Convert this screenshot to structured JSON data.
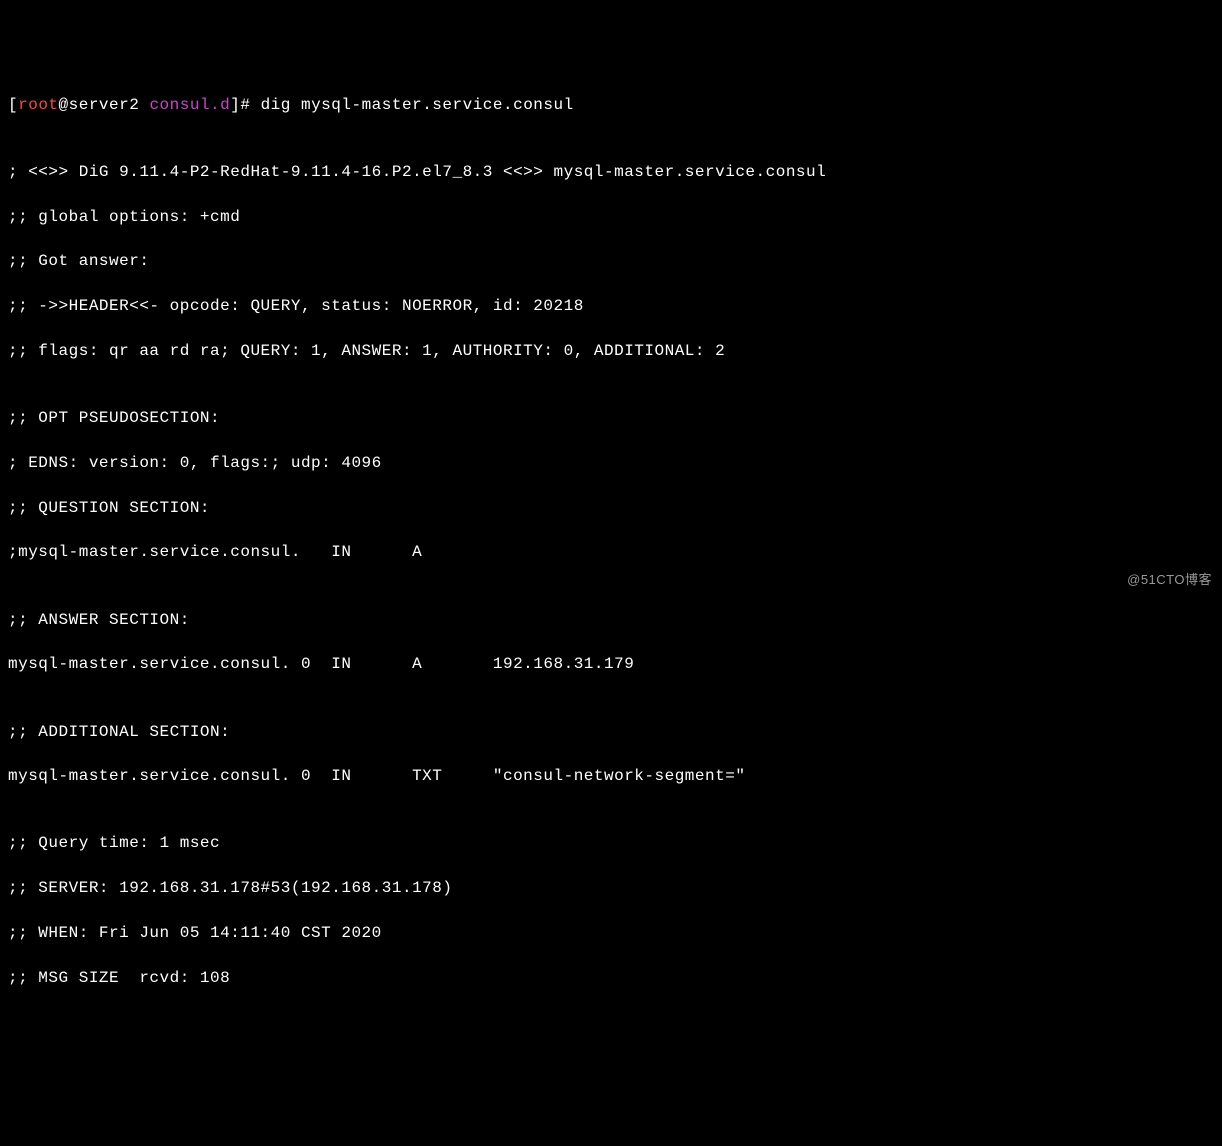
{
  "prompt": {
    "open_bracket": "[",
    "user": "root",
    "at": "@server2 ",
    "dir": "consul.d",
    "close_bracket": "]# ",
    "command": "dig mysql-master.service.consul"
  },
  "output": {
    "blank1": "",
    "banner": "; <<>> DiG 9.11.4-P2-RedHat-9.11.4-16.P2.el7_8.3 <<>> mysql-master.service.consul",
    "global_options": ";; global options: +cmd",
    "got_answer": ";; Got answer:",
    "header": ";; ->>HEADER<<- opcode: QUERY, status: NOERROR, id: 20218",
    "flags": ";; flags: qr aa rd ra; QUERY: 1, ANSWER: 1, AUTHORITY: 0, ADDITIONAL: 2",
    "blank2": "",
    "opt_header": ";; OPT PSEUDOSECTION:",
    "edns": "; EDNS: version: 0, flags:; udp: 4096",
    "question_header": ";; QUESTION SECTION:",
    "question_record": ";mysql-master.service.consul.   IN      A",
    "blank3": "",
    "answer_header": ";; ANSWER SECTION:",
    "answer_record": "mysql-master.service.consul. 0  IN      A       192.168.31.179",
    "blank4": "",
    "additional_header": ";; ADDITIONAL SECTION:",
    "additional_record": "mysql-master.service.consul. 0  IN      TXT     \"consul-network-segment=\"",
    "blank5": "",
    "query_time": ";; Query time: 1 msec",
    "server": ";; SERVER: 192.168.31.178#53(192.168.31.178)",
    "when": ";; WHEN: Fri Jun 05 14:11:40 CST 2020",
    "msg_size": ";; MSG SIZE  rcvd: 108"
  },
  "watermark": "@51CTO博客"
}
